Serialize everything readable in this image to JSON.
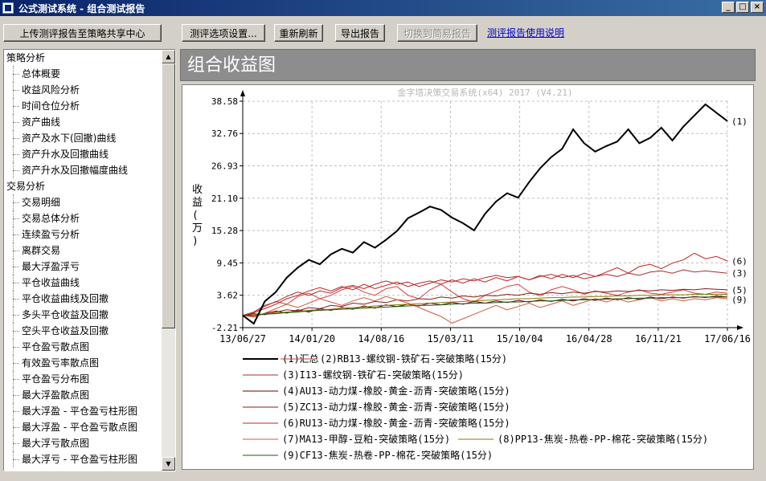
{
  "window": {
    "title": "公式测试系统 - 组合测试报告",
    "controls": [
      "_",
      "□",
      "×"
    ]
  },
  "toolbar": {
    "upload_label": "上传测评报告至策略共享中心",
    "options_label": "测评选项设置...",
    "refresh_label": "重新刷新",
    "export_label": "导出报告",
    "simple_label": "切换到简易报告",
    "help_link": "测评报告使用说明"
  },
  "tree": {
    "groups": [
      {
        "label": "策略分析",
        "items": [
          "总体概要",
          "收益风险分析",
          "时间仓位分析",
          "资产曲线",
          "资产及水下(回撤)曲线",
          "资产升水及回撤曲线",
          "资产升水及回撤幅度曲线"
        ]
      },
      {
        "label": "交易分析",
        "items": [
          "交易明细",
          "交易总体分析",
          "连续盈亏分析",
          "离群交易",
          "最大浮盈浮亏",
          "平仓收益曲线",
          "平仓收益曲线及回撤",
          "多头平仓收益及回撤",
          "空头平仓收益及回撤",
          "平仓盈亏散点图",
          "有效盈亏率散点图",
          "平仓盈亏分布图",
          "最大浮盈散点图",
          "最大浮盈 - 平仓盈亏柱形图",
          "最大浮盈 - 平仓盈亏散点图",
          "最大浮亏散点图",
          "最大浮亏 - 平仓盈亏柱形图"
        ]
      }
    ]
  },
  "panel": {
    "header": "组合收益图"
  },
  "chart_data": {
    "type": "line",
    "watermark": "金字塔决策交易系统(x64) 2017 (V4.21)",
    "ylabel": "收益(万)",
    "y_ticks": [
      "38.58",
      "32.76",
      "26.93",
      "21.10",
      "15.28",
      "9.45",
      "3.62",
      "-2.21"
    ],
    "x_ticks": [
      "13/06/27",
      "14/01/20",
      "14/08/16",
      "15/03/11",
      "15/10/04",
      "16/04/28",
      "16/11/21",
      "17/06/16"
    ],
    "ylim": [
      -2.21,
      38.58
    ],
    "grid": true,
    "end_labels": [
      "(1)",
      "(6)",
      "(3)",
      "(5)",
      "(9)"
    ],
    "series": [
      {
        "name": "(1)汇总",
        "color": "#000000",
        "values": [
          0,
          -1.5,
          2.5,
          4.2,
          6.8,
          8.6,
          10.0,
          9.2,
          11.0,
          12.0,
          11.3,
          13.2,
          12.2,
          13.6,
          15.2,
          17.5,
          18.5,
          19.6,
          19.0,
          17.6,
          16.6,
          15.3,
          18.3,
          20.5,
          22.0,
          21.2,
          24.0,
          26.5,
          28.5,
          30.0,
          33.5,
          31.0,
          29.5,
          30.5,
          31.3,
          33.5,
          31.0,
          32.0,
          33.8,
          31.5,
          34.0,
          36.0,
          38.0,
          36.5,
          35.0
        ]
      },
      {
        "name": "(2)RB13-螺纹钢-铁矿石-突破策略(15分)",
        "color": "#e03a3a",
        "values": [
          0,
          0.4,
          1.6,
          2.5,
          2.0,
          3.4,
          4.0,
          3.0,
          3.6,
          4.6,
          5.2,
          4.2,
          3.6,
          4.8,
          5.2,
          3.6,
          3.0,
          4.6,
          5.6,
          4.2,
          3.0,
          2.4,
          3.6,
          4.4,
          5.2,
          5.6,
          4.2,
          3.5,
          4.6,
          5.2,
          4.6,
          3.8,
          4.4,
          4.0,
          3.6,
          4.2,
          4.6,
          4.0,
          3.8,
          4.2,
          4.6,
          4.0,
          3.8,
          4.2,
          4.0
        ]
      },
      {
        "name": "(3)I13-螺纹钢-铁矿石-突破策略(15分)",
        "color": "#b02a2a",
        "values": [
          0,
          0.6,
          1.8,
          2.4,
          3.4,
          4.2,
          3.6,
          4.4,
          4.0,
          5.0,
          5.4,
          4.8,
          5.6,
          6.2,
          5.6,
          6.0,
          5.2,
          5.8,
          6.4,
          6.0,
          6.6,
          6.2,
          6.8,
          7.2,
          6.8,
          7.0,
          6.4,
          7.0,
          7.4,
          6.8,
          7.2,
          6.6,
          7.0,
          7.4,
          7.0,
          7.6,
          7.2,
          7.8,
          8.0,
          7.6,
          8.2,
          7.8,
          8.0,
          7.8,
          7.6
        ]
      },
      {
        "name": "(4)AU13-动力煤-橡胶-黄金-沥青-突破策略(15分)",
        "color": "#6a0000",
        "values": [
          0,
          -0.2,
          0.3,
          0.8,
          0.4,
          1.0,
          0.6,
          1.2,
          0.9,
          1.4,
          1.1,
          1.7,
          1.3,
          1.9,
          1.6,
          2.0,
          1.7,
          2.2,
          1.9,
          2.3,
          2.0,
          2.5,
          2.2,
          2.6,
          2.3,
          2.7,
          2.4,
          2.8,
          2.5,
          2.9,
          2.6,
          3.0,
          2.7,
          3.1,
          2.8,
          3.2,
          2.9,
          3.3,
          3.0,
          3.3,
          3.1,
          3.4,
          3.2,
          3.5,
          3.3
        ]
      },
      {
        "name": "(5)ZC13-动力煤-橡胶-黄金-沥青-突破策略(15分)",
        "color": "#8a1a1a",
        "values": [
          0,
          0.3,
          0.1,
          0.6,
          1.0,
          0.8,
          1.4,
          1.2,
          1.8,
          1.6,
          2.2,
          2.0,
          2.5,
          2.3,
          2.8,
          2.6,
          3.0,
          2.9,
          3.3,
          3.1,
          3.5,
          3.3,
          3.6,
          3.5,
          3.8,
          3.6,
          4.0,
          3.8,
          4.1,
          3.9,
          4.2,
          4.0,
          4.3,
          4.2,
          4.4,
          4.3,
          4.5,
          4.4,
          4.6,
          4.5,
          4.7,
          4.6,
          4.8,
          4.7,
          4.6
        ]
      },
      {
        "name": "(6)RU13-动力煤-橡胶-黄金-沥青-突破策略(15分)",
        "color": "#c82020",
        "values": [
          0,
          0.5,
          1.2,
          2.0,
          3.0,
          3.6,
          4.4,
          5.0,
          4.4,
          5.2,
          4.6,
          5.6,
          4.8,
          5.4,
          6.0,
          5.2,
          5.8,
          6.2,
          5.6,
          6.4,
          5.8,
          6.6,
          6.0,
          6.8,
          6.2,
          7.0,
          6.4,
          7.2,
          6.6,
          7.4,
          6.8,
          7.6,
          7.0,
          7.8,
          8.6,
          7.6,
          8.8,
          9.2,
          8.4,
          9.4,
          10.0,
          11.2,
          10.2,
          10.6,
          9.8
        ]
      },
      {
        "name": "(7)MA13-甲醇-豆粕-突破策略(15分)",
        "color": "#d05a3a",
        "values": [
          0,
          -0.3,
          0.4,
          1.2,
          2.0,
          1.4,
          2.2,
          3.0,
          2.4,
          1.8,
          2.6,
          3.2,
          2.6,
          3.4,
          2.8,
          2.2,
          1.4,
          0.6,
          -0.2,
          -1.4,
          -0.6,
          0.2,
          1.0,
          1.8,
          1.0,
          1.6,
          2.2,
          1.4,
          2.0,
          2.6,
          1.8,
          2.4,
          3.0,
          2.4,
          3.0,
          2.4,
          2.8,
          3.2,
          2.6,
          3.0,
          2.6,
          3.0,
          2.8,
          3.2,
          3.0
        ]
      },
      {
        "name": "(8)PP13-焦炭-热卷-PP-棉花-突破策略(15分)",
        "color": "#8a7a00",
        "values": [
          0,
          0.1,
          0.3,
          0.4,
          0.6,
          0.7,
          0.9,
          1.0,
          1.1,
          1.3,
          1.4,
          1.5,
          1.7,
          1.8,
          1.9,
          2.0,
          2.1,
          2.2,
          2.3,
          2.4,
          2.5,
          2.6,
          2.7,
          2.8,
          2.9,
          3.0,
          3.0,
          3.1,
          3.2,
          3.2,
          3.3,
          3.3,
          3.4,
          3.4,
          3.5,
          3.5,
          3.6,
          3.6,
          3.7,
          3.7,
          3.7,
          3.8,
          3.8,
          3.8,
          3.8
        ]
      },
      {
        "name": "(9)CF13-焦炭-热卷-PP-棉花-突破策略(15分)",
        "color": "#1a5a1a",
        "values": [
          0,
          0.05,
          0.2,
          0.3,
          0.5,
          0.6,
          0.8,
          0.9,
          1.0,
          1.1,
          1.2,
          1.3,
          1.4,
          1.5,
          1.6,
          1.7,
          1.8,
          1.8,
          1.9,
          2.0,
          2.1,
          2.2,
          2.2,
          2.3,
          2.4,
          2.4,
          2.5,
          2.6,
          2.6,
          2.7,
          2.8,
          2.8,
          2.9,
          2.9,
          3.0,
          3.0,
          3.1,
          3.1,
          3.2,
          3.2,
          3.2,
          3.3,
          3.3,
          3.3,
          3.3
        ]
      }
    ]
  }
}
